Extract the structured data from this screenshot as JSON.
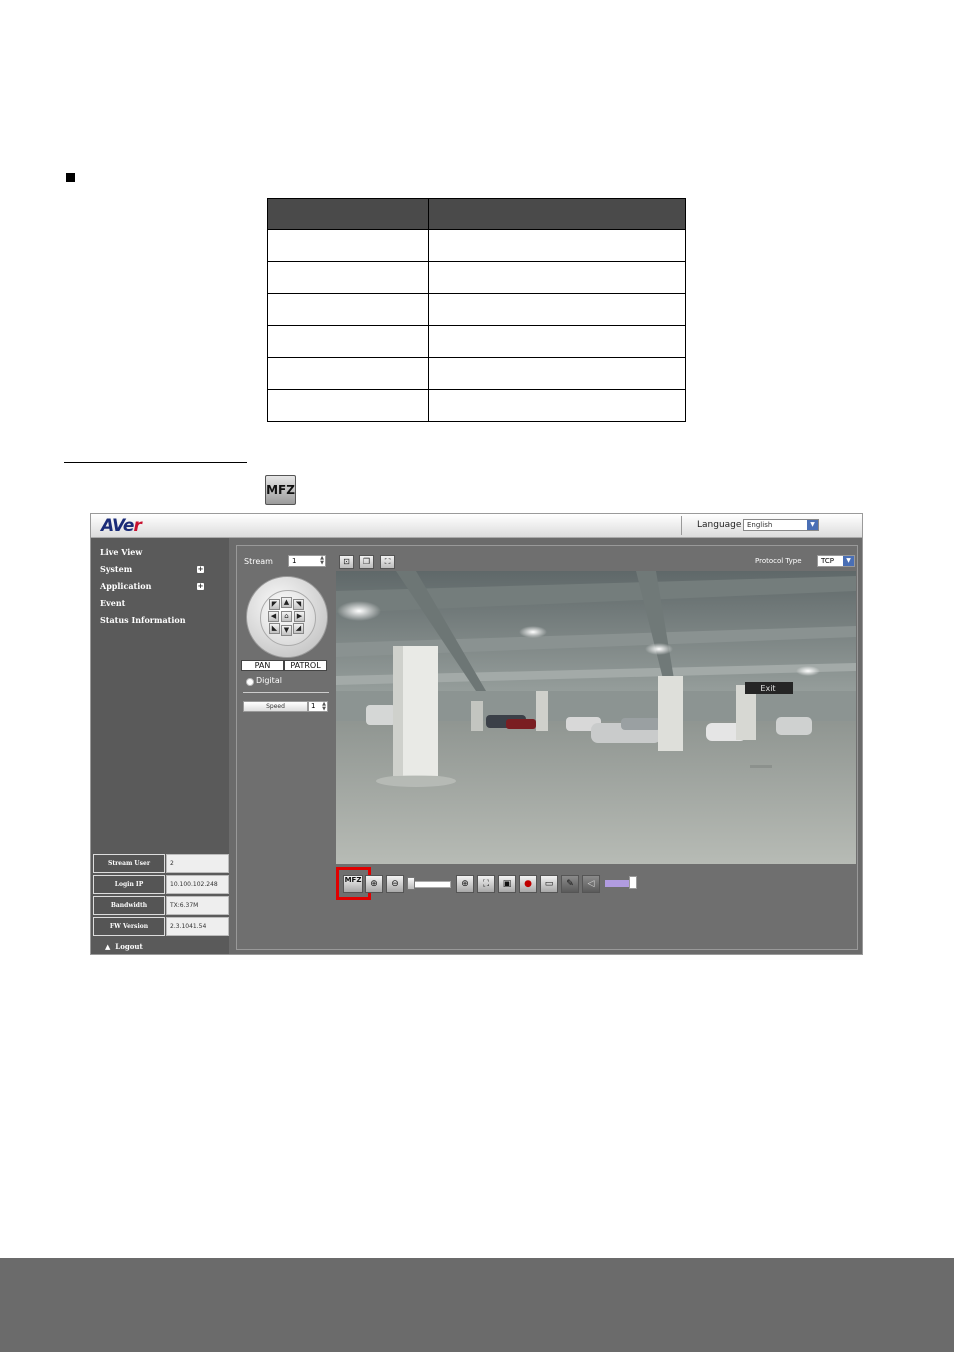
{
  "document": {
    "inline_button_label": "MFZ"
  },
  "app": {
    "logo_text_a": "AVe",
    "logo_text_b": "r",
    "language_label": "Language",
    "language_value": "English"
  },
  "sidebar": {
    "items": [
      {
        "label": "Live View",
        "expandable": false
      },
      {
        "label": "System",
        "expandable": true
      },
      {
        "label": "Application",
        "expandable": true
      },
      {
        "label": "Event",
        "expandable": false
      },
      {
        "label": "Status Information",
        "expandable": false
      }
    ],
    "info": [
      {
        "key": "Stream User",
        "value": "2"
      },
      {
        "key": "Login IP",
        "value": "10.100.102.248"
      },
      {
        "key": "Bandwidth",
        "value": "TX:6.37M"
      },
      {
        "key": "FW Version",
        "value": "2.3.1041.54"
      }
    ],
    "logout_label": "Logout"
  },
  "controls": {
    "stream_label": "Stream",
    "stream_value": "1",
    "pan_label": "PAN",
    "patrol_label": "PATROL",
    "digital_label": "Digital",
    "speed_label": "Speed",
    "speed_value": "1",
    "protocol_label": "Protocol Type",
    "protocol_value": "TCP",
    "mfz_label": "MFZ"
  },
  "video": {
    "exit_sign": "Exit"
  },
  "colors": {
    "highlight": "#e00000",
    "logo_blue": "#1a2b78",
    "logo_red": "#c8102e",
    "sidebar_bg": "#5a5a5a",
    "footer_bg": "#6b6b6b"
  }
}
